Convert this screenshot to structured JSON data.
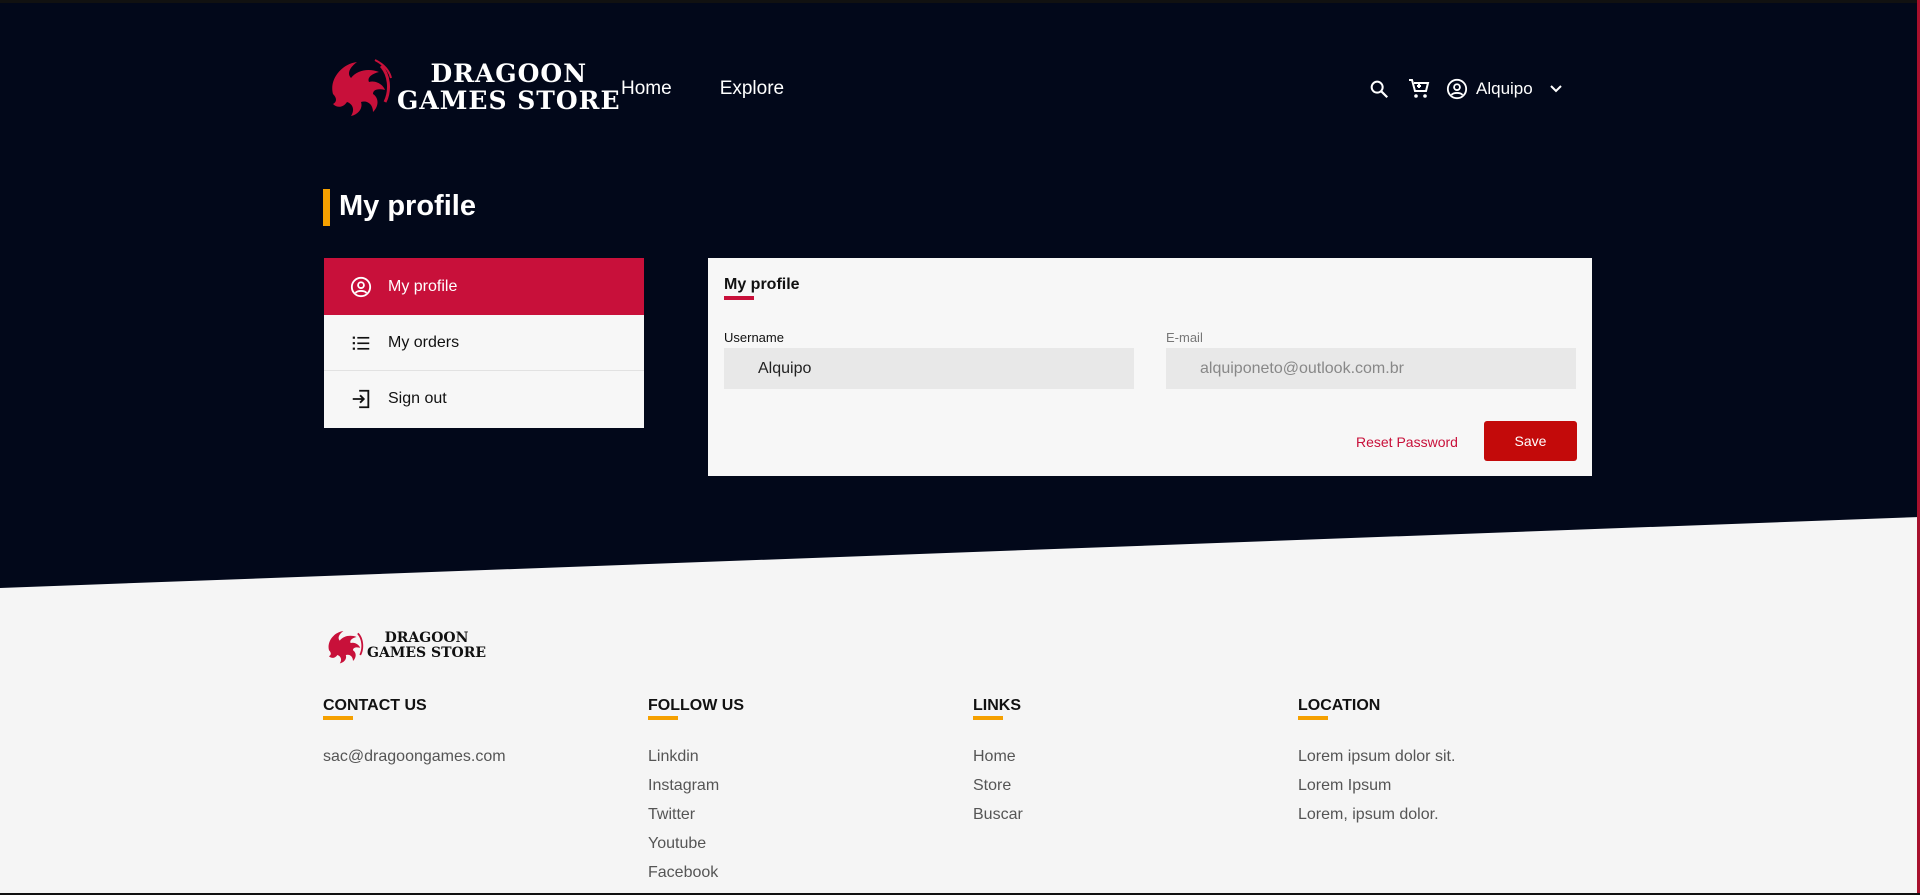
{
  "brand": {
    "line1": "DRAGOON",
    "line2": "GAMES STORE",
    "color": "#c8103a"
  },
  "nav": {
    "items": [
      "Home",
      "Explore"
    ]
  },
  "header": {
    "user_name": "Alquipo",
    "icons": [
      "search-icon",
      "cart-icon",
      "user-circle-icon",
      "chevron-down-icon"
    ]
  },
  "page": {
    "title": "My profile",
    "accent": "#f5a000"
  },
  "sidebar": {
    "items": [
      {
        "label": "My profile",
        "icon": "user-circle-icon",
        "active": true
      },
      {
        "label": "My orders",
        "icon": "list-icon",
        "active": false
      },
      {
        "label": "Sign out",
        "icon": "sign-out-icon",
        "active": false
      }
    ]
  },
  "profile_form": {
    "title": "My profile",
    "username_label": "Username",
    "username_value": "Alquipo",
    "email_label": "E-mail",
    "email_value": "alquiponeto@outlook.com.br",
    "reset_label": "Reset Password",
    "save_label": "Save"
  },
  "footer": {
    "brand": {
      "line1": "DRAGOON",
      "line2": "GAMES STORE"
    },
    "columns": [
      {
        "heading": "CONTACT US",
        "items": [
          "sac@dragoongames.com"
        ]
      },
      {
        "heading": "FOLLOW US",
        "items": [
          "Linkdin",
          "Instagram",
          "Twitter",
          "Youtube",
          "Facebook"
        ]
      },
      {
        "heading": "LINKS",
        "items": [
          "Home",
          "Store",
          "Buscar"
        ]
      },
      {
        "heading": "LOCATION",
        "items": [
          "Lorem ipsum dolor sit.",
          "Lorem Ipsum",
          "Lorem, ipsum dolor."
        ]
      }
    ]
  },
  "colors": {
    "hero_bg": "#02081a",
    "primary": "#c8103a",
    "save_button": "#c30a0a",
    "footer_bg": "#f5f5f5"
  }
}
